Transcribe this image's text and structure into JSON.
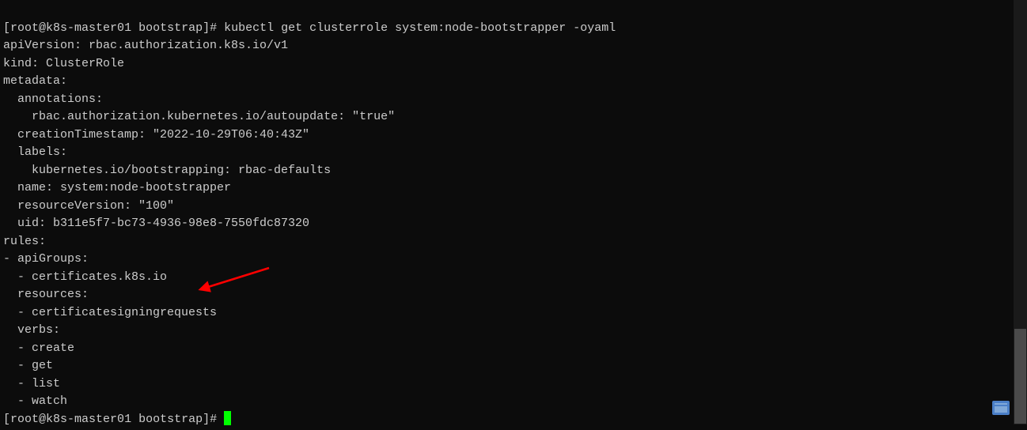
{
  "prompt1": {
    "user": "root",
    "host": "k8s-master01",
    "path": "bootstrap",
    "command": "kubectl get clusterrole system:node-bootstrapper -oyaml"
  },
  "output": {
    "line1": "apiVersion: rbac.authorization.k8s.io/v1",
    "line2": "kind: ClusterRole",
    "line3": "metadata:",
    "line4": "  annotations:",
    "line5": "    rbac.authorization.kubernetes.io/autoupdate: \"true\"",
    "line6": "  creationTimestamp: \"2022-10-29T06:40:43Z\"",
    "line7": "  labels:",
    "line8": "    kubernetes.io/bootstrapping: rbac-defaults",
    "line9": "  name: system:node-bootstrapper",
    "line10": "  resourceVersion: \"100\"",
    "line11": "  uid: b311e5f7-bc73-4936-98e8-7550fdc87320",
    "line12": "rules:",
    "line13": "- apiGroups:",
    "line14": "  - certificates.k8s.io",
    "line15": "  resources:",
    "line16": "  - certificatesigningrequests",
    "line17": "  verbs:",
    "line18": "  - create",
    "line19": "  - get",
    "line20": "  - list",
    "line21": "  - watch"
  },
  "prompt2": {
    "user": "root",
    "host": "k8s-master01",
    "path": "bootstrap"
  }
}
